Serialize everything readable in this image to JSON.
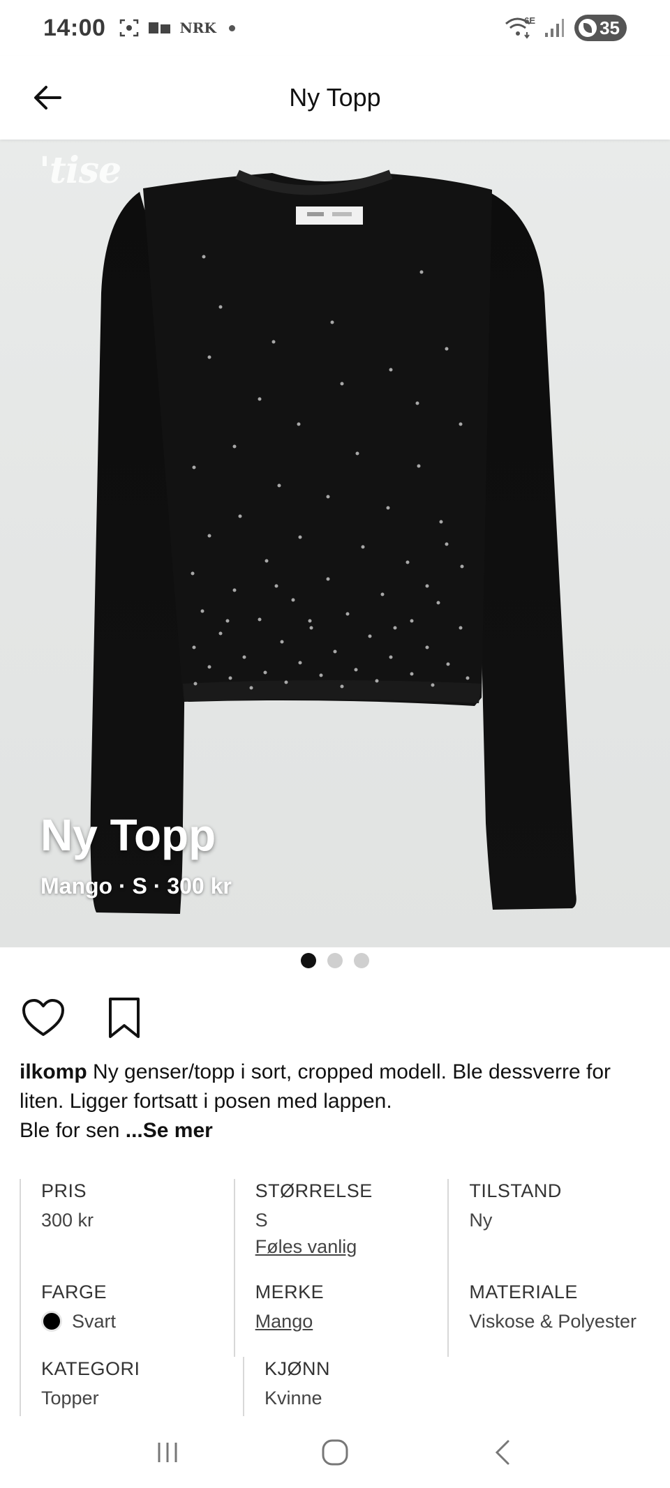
{
  "status_bar": {
    "time": "14:00",
    "left_icons": [
      "screenshot-icon",
      "gallery-icon",
      "nrk-icon",
      "dot-icon"
    ],
    "nrk_label": "NRK",
    "network_label": "6E",
    "battery": "35"
  },
  "app_bar": {
    "title": "Ny Topp"
  },
  "hero": {
    "watermark": "'tise",
    "overlay_title": "Ny Topp",
    "overlay_subtitle": "Mango · S · 300 kr",
    "image_index": 1,
    "image_count": 3
  },
  "actions": {
    "like_icon": "heart-icon",
    "save_icon": "bookmark-icon"
  },
  "description": {
    "username": "ilkomp",
    "text": " Ny genser/topp i sort, cropped modell. Ble dessverre for liten. Ligger fortsatt i posen med lappen.",
    "text_line2": "Ble for sen ",
    "see_more": "...Se mer"
  },
  "details": {
    "price": {
      "label": "PRIS",
      "value": "300 kr"
    },
    "size": {
      "label": "STØRRELSE",
      "value": "S",
      "sub": "Føles vanlig"
    },
    "condition": {
      "label": "TILSTAND",
      "value": "Ny"
    },
    "color": {
      "label": "FARGE",
      "value": "Svart",
      "swatch": "#000000"
    },
    "brand": {
      "label": "MERKE",
      "value": "Mango"
    },
    "material": {
      "label": "MATERIALE",
      "value": "Viskose & Polyester"
    },
    "category": {
      "label": "KATEGORI",
      "value": "Topper"
    },
    "gender": {
      "label": "KJØNN",
      "value": "Kvinne"
    }
  },
  "nav_bar": {
    "icons": [
      "recent-apps-icon",
      "home-icon",
      "back-nav-icon"
    ]
  }
}
